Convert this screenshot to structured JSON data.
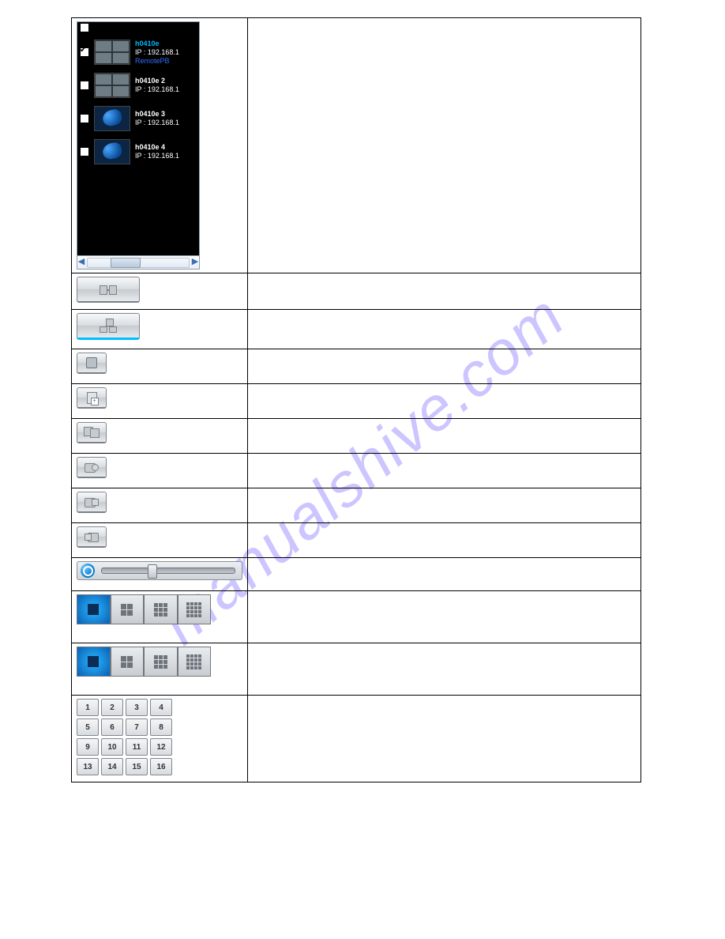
{
  "watermark": "manualshive.com",
  "camera_list": {
    "items": [
      {
        "name": "h0410e",
        "ip": "IP : 192.168.1",
        "extra": "RemotePB",
        "checked": true,
        "thumb": "quad"
      },
      {
        "name": "h0410e 2",
        "ip": "IP : 192.168.1",
        "checked": false,
        "thumb": "quad"
      },
      {
        "name": "h0410e 3",
        "ip": "IP : 192.168.1",
        "checked": false,
        "thumb": "ptz"
      },
      {
        "name": "h0410e 4",
        "ip": "IP : 192.168.1",
        "checked": false,
        "thumb": "ptz"
      }
    ]
  },
  "keypad": [
    "1",
    "2",
    "3",
    "4",
    "5",
    "6",
    "7",
    "8",
    "9",
    "10",
    "11",
    "12",
    "13",
    "14",
    "15",
    "16"
  ]
}
